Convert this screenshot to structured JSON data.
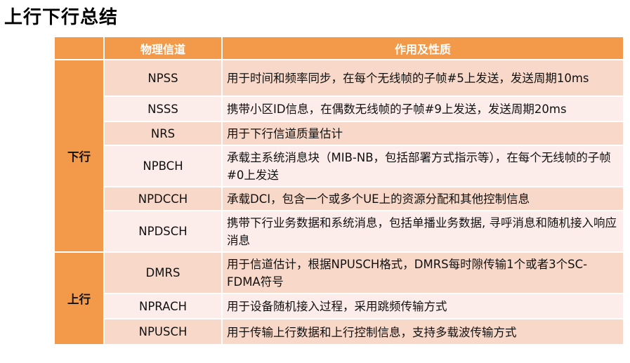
{
  "title": "上行下行总结",
  "table": {
    "headers": [
      "",
      "物理信道",
      "作用及性质"
    ],
    "groups": [
      {
        "label": "下行",
        "rows": [
          {
            "channel": "NPSS",
            "desc": "用于时间和频率同步，在每个无线帧的子帧#5上发送，发送周期10ms"
          },
          {
            "channel": "NSSS",
            "desc": "携带小区ID信息，在偶数无线帧的子帧#9上发送，发送周期20ms"
          },
          {
            "channel": "NRS",
            "desc": "用于下行信道质量估计"
          },
          {
            "channel": "NPBCH",
            "desc": "承载主系统消息块（MIB-NB，包括部署方式指示等），在每个无线帧的子帧#0上发送"
          },
          {
            "channel": "NPDCCH",
            "desc": "承载DCI，包含一个或多个UE上的资源分配和其他控制信息"
          },
          {
            "channel": "NPDSCH",
            "desc": "携带下行业务数据和系统消息，包括单播业务数据, 寻呼消息和随机接入响应消息"
          }
        ]
      },
      {
        "label": "上行",
        "rows": [
          {
            "channel": "DMRS",
            "desc": "用于信道估计，根据NPUSCH格式，DMRS每时隙传输1个或者3个SC-FDMA符号"
          },
          {
            "channel": "NPRACH",
            "desc": "用于设备随机接入过程，采用跳频传输方式"
          },
          {
            "channel": "NPUSCH",
            "desc": "用于传输上行数据和上行控制信息，支持多载波传输方式"
          }
        ]
      }
    ]
  },
  "colors": {
    "header_orange": "#f39a4a",
    "row_dark": "#f8d8c8",
    "row_light": "#fcecea"
  }
}
